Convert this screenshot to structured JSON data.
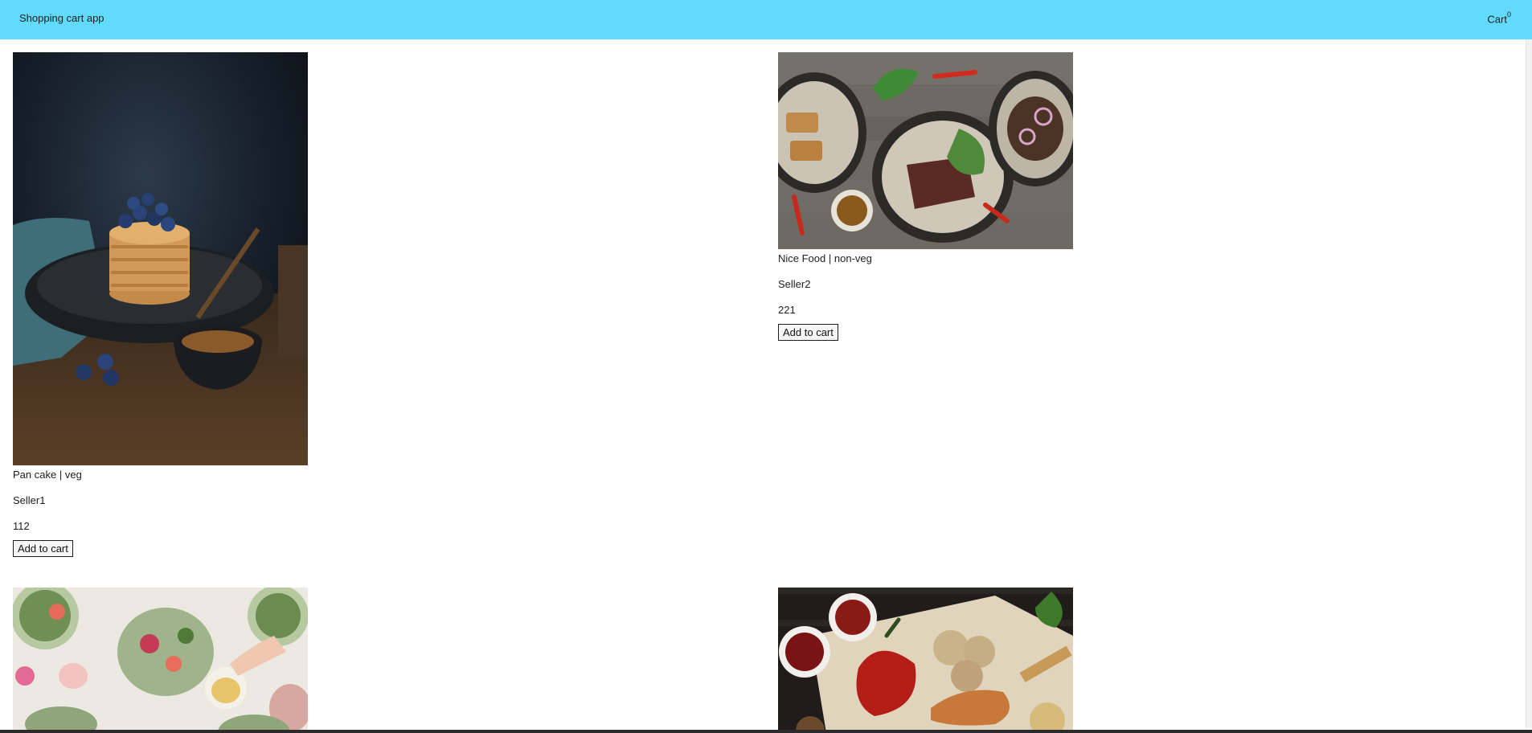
{
  "header": {
    "title": "Shopping cart app",
    "cart_label": "Cart",
    "cart_count": "0",
    "bar_color": "#61dafb"
  },
  "products": [
    {
      "name": "Pan cake",
      "separator": "|",
      "type": "veg",
      "seller": "Seller1",
      "price": "112",
      "button_label": "Add to cart",
      "image_icon": "pancake-photo"
    },
    {
      "name": "Nice Food",
      "separator": "|",
      "type": "non-veg",
      "seller": "Seller2",
      "price": "221",
      "button_label": "Add to cart",
      "image_icon": "steak-platter-photo"
    },
    {
      "image_icon": "salad-table-photo"
    },
    {
      "image_icon": "grilled-vegetables-photo"
    }
  ]
}
